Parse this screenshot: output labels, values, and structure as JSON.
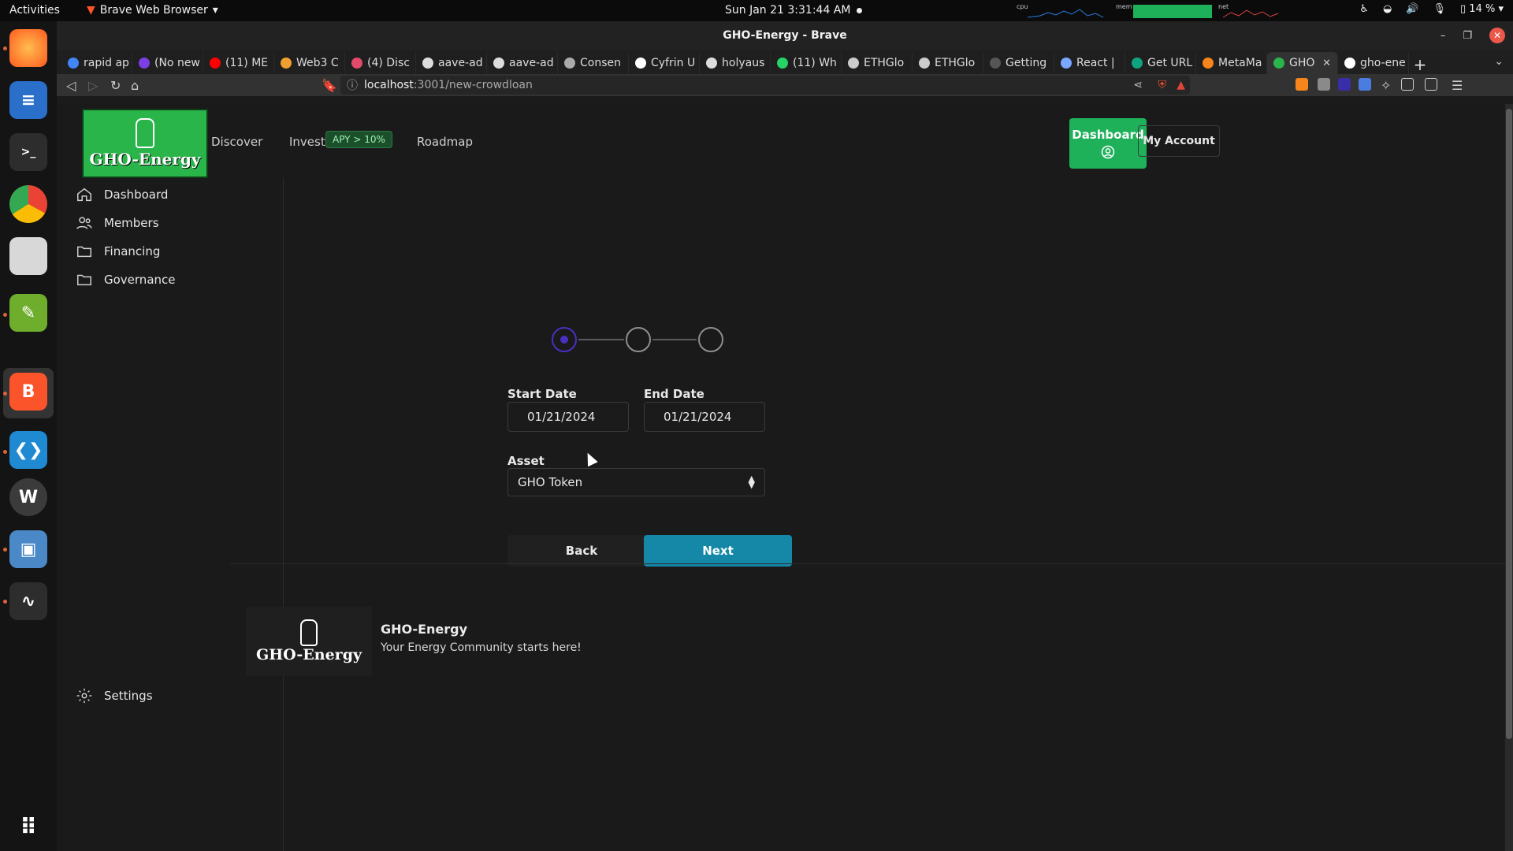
{
  "system": {
    "activities": "Activities",
    "app_menu": "Brave Web Browser",
    "clock": "Sun Jan 21  3:31:44 AM",
    "cpu_label": "cpu",
    "mem_label": "mem",
    "net_label": "net",
    "battery": "14 %"
  },
  "window": {
    "title": "GHO-Energy - Brave"
  },
  "tabs": [
    {
      "label": "rapid ap",
      "color": "#4285f4"
    },
    {
      "label": "(No new",
      "color": "#7b3fe4"
    },
    {
      "label": "(11) ME",
      "color": "#ff0000"
    },
    {
      "label": "Web3 C",
      "color": "#f0a030"
    },
    {
      "label": "(4) Disc",
      "color": "#e24a6a"
    },
    {
      "label": "aave-ad",
      "color": "#dddddd"
    },
    {
      "label": "aave-ad",
      "color": "#dddddd"
    },
    {
      "label": "Consen",
      "color": "#aaaaaa"
    },
    {
      "label": "Cyfrin U",
      "color": "#ffffff"
    },
    {
      "label": "holyaus",
      "color": "#dddddd"
    },
    {
      "label": "(11) Wh",
      "color": "#25d366"
    },
    {
      "label": "ETHGlo",
      "color": "#cccccc"
    },
    {
      "label": "ETHGlo",
      "color": "#cccccc"
    },
    {
      "label": "Getting",
      "color": "#555555"
    },
    {
      "label": "React |",
      "color": "#7aa7ff"
    },
    {
      "label": "Get URL",
      "color": "#10a37f"
    },
    {
      "label": "MetaMa",
      "color": "#f6851b"
    },
    {
      "label": "GHO",
      "color": "#2ab54b",
      "active": true
    },
    {
      "label": "gho-ene",
      "color": "#ffffff"
    }
  ],
  "url": {
    "host": "localhost",
    "path": ":3001/new-crowdloan"
  },
  "header": {
    "brand": "GHO-Energy",
    "nav": {
      "discover": "Discover",
      "invest": "Invest",
      "apy": "APY > 10%",
      "roadmap": "Roadmap"
    },
    "dashboard": "Dashboard",
    "my_account": "My Account"
  },
  "sidebar": {
    "items": [
      {
        "label": "Dashboard",
        "icon": "home-icon"
      },
      {
        "label": "Members",
        "icon": "users-icon"
      },
      {
        "label": "Financing",
        "icon": "folder-icon"
      },
      {
        "label": "Governance",
        "icon": "folder-icon"
      }
    ],
    "settings": "Settings"
  },
  "form": {
    "start_label": "Start Date",
    "start_value": "01/21/2024",
    "end_label": "End Date",
    "end_value": "01/21/2024",
    "asset_label": "Asset",
    "asset_value": "GHO Token",
    "back": "Back",
    "next": "Next",
    "stepper_active": 1,
    "stepper_total": 3
  },
  "footer": {
    "brand": "GHO-Energy",
    "title": "GHO-Energy",
    "tagline": "Your Energy Community starts here!"
  },
  "colors": {
    "brand_green": "#2ab54b",
    "next_button": "#1588a8",
    "step_active": "#4b2ec2"
  }
}
